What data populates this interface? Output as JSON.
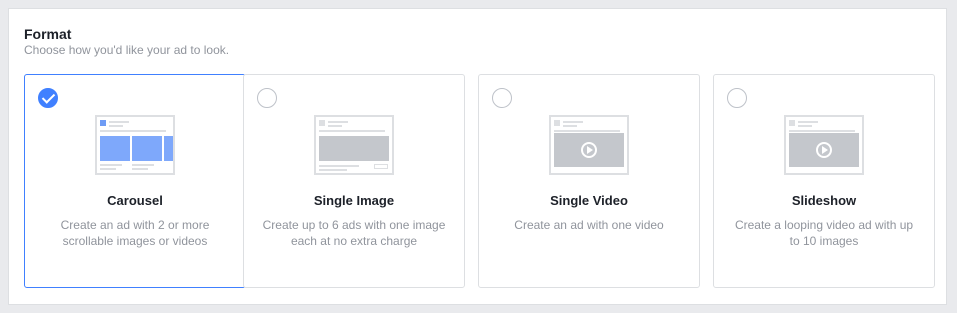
{
  "section": {
    "title": "Format",
    "subtitle": "Choose how you'd like your ad to look."
  },
  "formats": [
    {
      "title": "Carousel",
      "description": "Create an ad with 2 or more scrollable images or videos",
      "selected": true,
      "icon": "carousel-preview-icon"
    },
    {
      "title": "Single Image",
      "description": "Create up to 6 ads with one image each at no extra charge",
      "selected": false,
      "icon": "single-image-preview-icon"
    },
    {
      "title": "Single Video",
      "description": "Create an ad with one video",
      "selected": false,
      "icon": "single-video-preview-icon"
    },
    {
      "title": "Slideshow",
      "description": "Create a looping video ad with up to 10 images",
      "selected": false,
      "icon": "slideshow-preview-icon"
    }
  ],
  "colors": {
    "accent": "#4080ff",
    "border": "#dddfe2",
    "muted": "#90949c"
  }
}
